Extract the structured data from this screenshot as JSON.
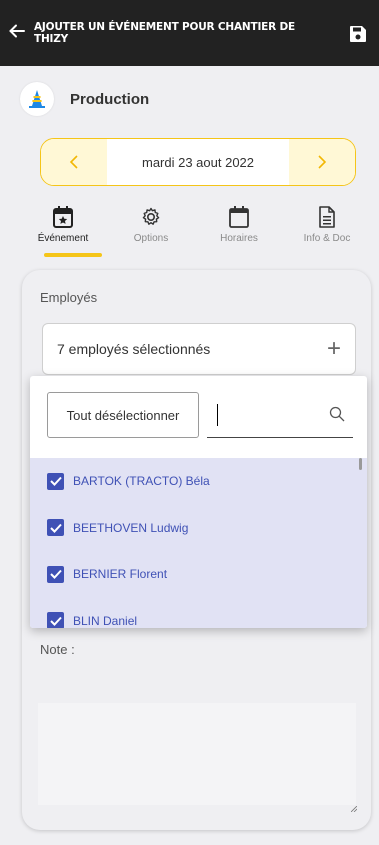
{
  "header": {
    "title": "AJOUTER UN ÉVÉNEMENT POUR CHANTIER DE THIZY",
    "back_icon": "arrow-left-icon",
    "save_icon": "floppy-disk-icon"
  },
  "project": {
    "name": "Production",
    "logo_icon": "cone-logo"
  },
  "date": {
    "label": "mardi 23 aout 2022",
    "prev": "‹",
    "next": "›"
  },
  "tabs": [
    {
      "label": "Événement",
      "icon": "calendar-star-icon",
      "active": true
    },
    {
      "label": "Options",
      "icon": "gear-icon",
      "active": false
    },
    {
      "label": "Horaires",
      "icon": "calendar-icon",
      "active": false
    },
    {
      "label": "Info & Doc",
      "icon": "document-icon",
      "active": false
    }
  ],
  "employees": {
    "label": "Employés",
    "selected_text": "7 employés sélectionnés",
    "add": "+",
    "deselect_all": "Tout désélectionner",
    "search_placeholder": "",
    "items": [
      {
        "name": "BARTOK (TRACTO) Béla",
        "checked": true
      },
      {
        "name": "BEETHOVEN Ludwig",
        "checked": true
      },
      {
        "name": "BERNIER Florent",
        "checked": true
      },
      {
        "name": "BLIN Daniel",
        "checked": true
      }
    ]
  },
  "note": {
    "label": "Note :"
  },
  "colors": {
    "accent": "#f5c518",
    "header_bg": "#222222",
    "list_bg": "#e1e2f4",
    "checkbox": "#3f51b5"
  }
}
